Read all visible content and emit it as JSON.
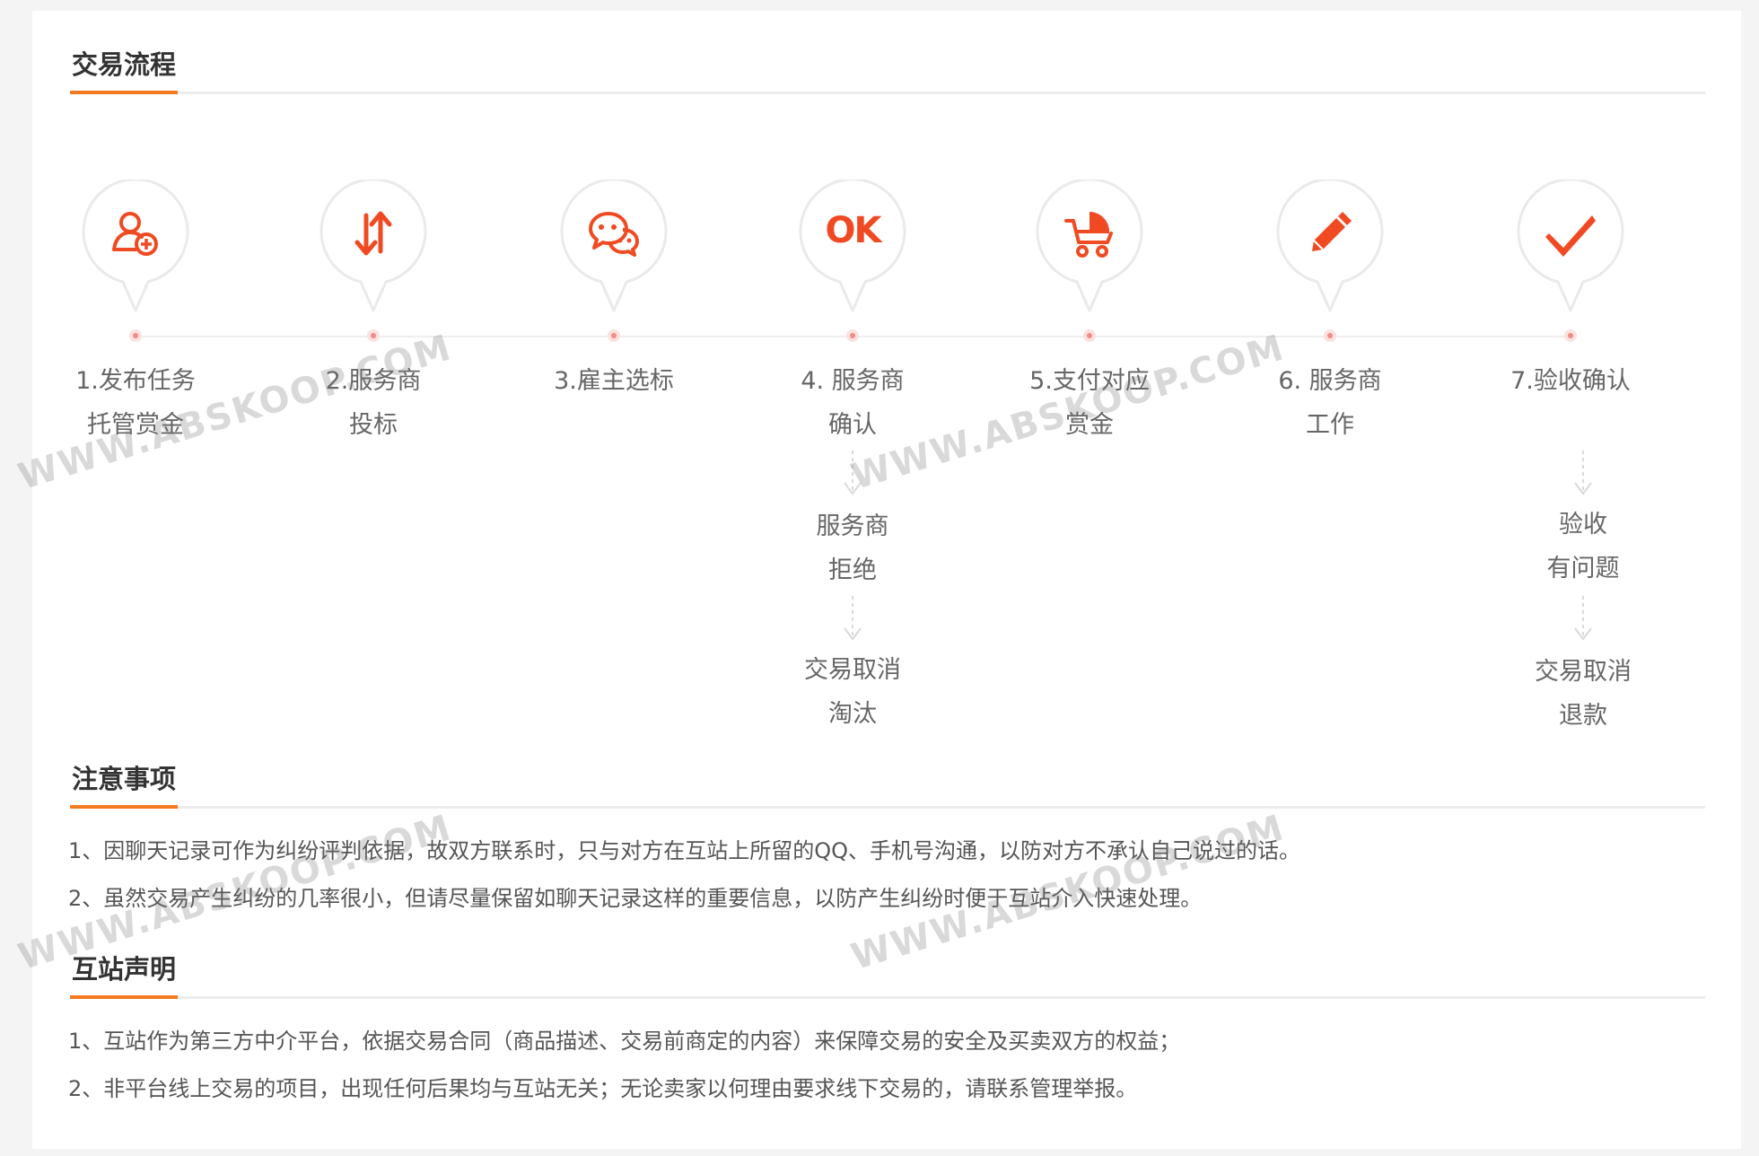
{
  "sections": {
    "process_title": "交易流程",
    "notice_title": "注意事项",
    "statement_title": "互站声明"
  },
  "steps": [
    {
      "lines": [
        "1.发布任务",
        "托管赏金"
      ],
      "icon": "user-add-icon"
    },
    {
      "lines": [
        "2.服务商",
        "投标"
      ],
      "icon": "exchange-arrows-icon"
    },
    {
      "lines": [
        "3.雇主选标"
      ],
      "icon": "chat-bubbles-icon"
    },
    {
      "lines": [
        "4. 服务商",
        "确认"
      ],
      "icon": "ok-icon"
    },
    {
      "lines": [
        "5.支付对应",
        "赏金"
      ],
      "icon": "cart-icon"
    },
    {
      "lines": [
        "6. 服务商",
        "工作"
      ],
      "icon": "pencil-icon"
    },
    {
      "lines": [
        "7.验收确认"
      ],
      "icon": "checkmark-icon"
    }
  ],
  "branch_left": {
    "first": [
      "服务商",
      "拒绝"
    ],
    "second": [
      "交易取消",
      "淘汰"
    ]
  },
  "branch_right": {
    "first": [
      "验收",
      "有问题"
    ],
    "second": [
      "交易取消",
      "退款"
    ]
  },
  "notice": [
    "1、因聊天记录可作为纠纷评判依据，故双方联系时，只与对方在互站上所留的QQ、手机号沟通，以防对方不承认自己说过的话。",
    "2、虽然交易产生纠纷的几率很小，但请尽量保留如聊天记录这样的重要信息，以防产生纠纷时便于互站介入快速处理。"
  ],
  "statement": [
    "1、互站作为第三方中介平台，依据交易合同（商品描述、交易前商定的内容）来保障交易的安全及买卖双方的权益；",
    "2、非平台线上交易的项目，出现任何后果均与互站无关；无论卖家以何理由要求线下交易的，请联系管理举报。"
  ],
  "watermark_text": "WWW.ABSKOOP.COM",
  "ok_glyph": "OK",
  "colors": {
    "accent": "#f47b20",
    "icon": "#f04a23",
    "pin_border": "#ececec",
    "dot": "#f28b86"
  }
}
